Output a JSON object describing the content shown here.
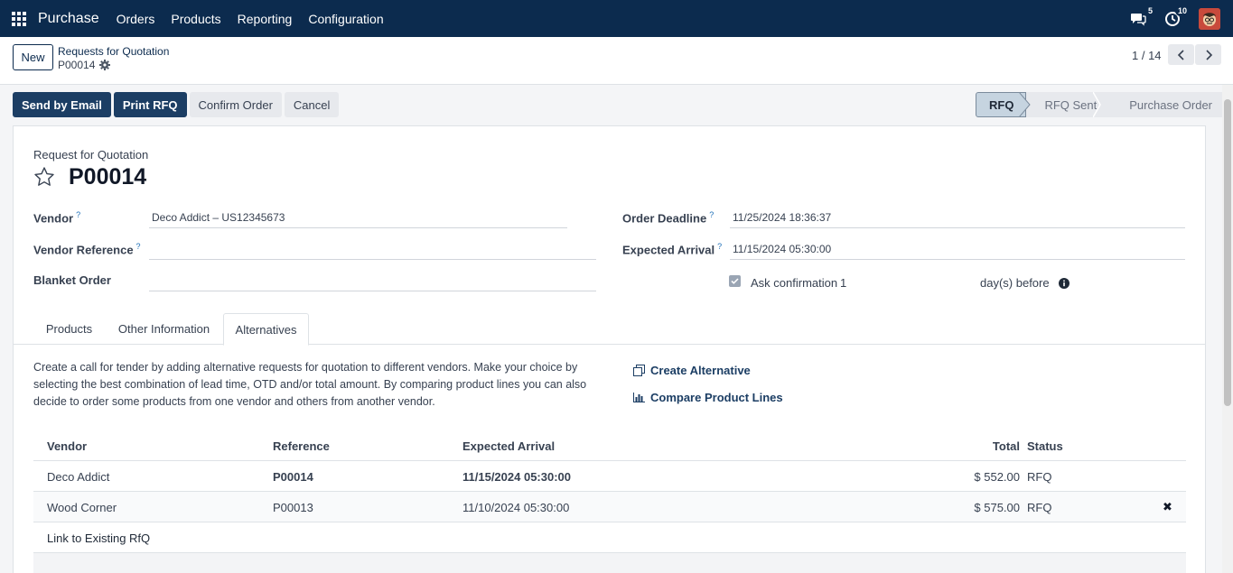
{
  "navbar": {
    "app_name": "Purchase",
    "menu": [
      "Orders",
      "Products",
      "Reporting",
      "Configuration"
    ],
    "messages_count": "5",
    "activities_count": "10"
  },
  "control": {
    "new_label": "New",
    "breadcrumb_parent": "Requests for Quotation",
    "breadcrumb_current": "P00014",
    "pager": "1 / 14"
  },
  "actions": {
    "send_email": "Send by Email",
    "print_rfq": "Print RFQ",
    "confirm_order": "Confirm Order",
    "cancel": "Cancel"
  },
  "statusbar": [
    "RFQ",
    "RFQ Sent",
    "Purchase Order"
  ],
  "form": {
    "title_label": "Request for Quotation",
    "title": "P00014",
    "vendor_label": "Vendor",
    "vendor_value": "Deco Addict – US12345673",
    "vendor_reference_label": "Vendor Reference",
    "vendor_reference_value": "",
    "blanket_order_label": "Blanket Order",
    "blanket_order_value": "",
    "order_deadline_label": "Order Deadline",
    "order_deadline_value": "11/25/2024 18:36:37",
    "expected_arrival_label": "Expected Arrival",
    "expected_arrival_value": "11/15/2024 05:30:00",
    "ask_confirmation_label": "Ask confirmation",
    "ask_confirmation_days": "1",
    "days_before": "day(s) before",
    "tooltip_mark": "?"
  },
  "tabs": [
    "Products",
    "Other Information",
    "Alternatives"
  ],
  "alternatives": {
    "description": "Create a call for tender by adding alternative requests for quotation to different vendors. Make your choice by selecting the best combination of lead time, OTD and/or total amount. By comparing product lines you can also decide to order some products from one vendor and others from another vendor.",
    "create_alternative": "Create Alternative",
    "compare_lines": "Compare Product Lines",
    "columns": {
      "vendor": "Vendor",
      "reference": "Reference",
      "expected_arrival": "Expected Arrival",
      "total": "Total",
      "status": "Status"
    },
    "rows": [
      {
        "vendor": "Deco Addict",
        "reference": "P00014",
        "expected_arrival": "11/15/2024 05:30:00",
        "total": "$ 552.00",
        "status": "RFQ"
      },
      {
        "vendor": "Wood Corner",
        "reference": "P00013",
        "expected_arrival": "11/10/2024 05:30:00",
        "total": "$ 575.00",
        "status": "RFQ"
      }
    ],
    "link_existing": "Link to Existing RfQ",
    "remove_symbol": "✖"
  },
  "colors": {
    "navbar": "#0c2b4e",
    "primary": "#1c3e64",
    "link": "#1e6fb8"
  }
}
